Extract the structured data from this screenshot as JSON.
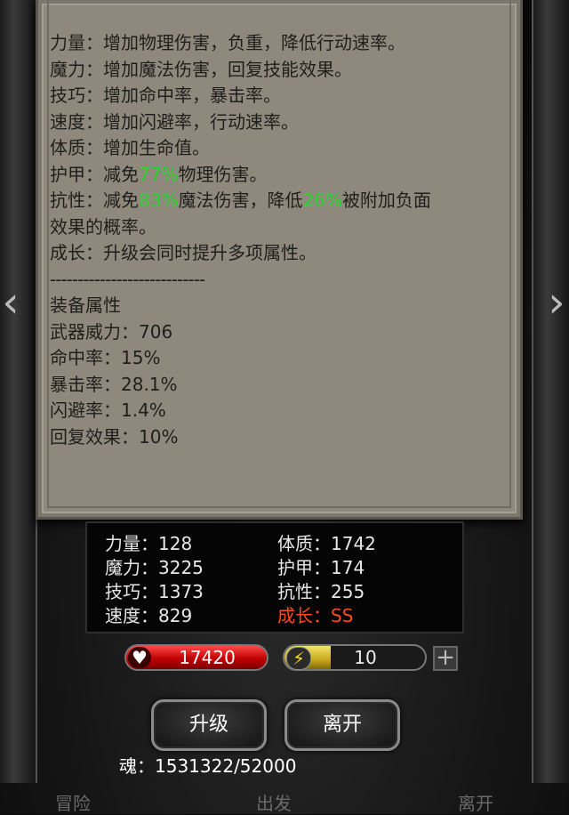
{
  "info": {
    "lines": [
      "力量：增加物理伤害，负重，降低行动速率。",
      "魔力：增加魔法伤害，回复技能效果。",
      "技巧：增加命中率，暴击率。",
      "速度：增加闪避率，行动速率。",
      "体质：增加生命值。"
    ],
    "armor_prefix": "护甲：减免",
    "armor_pct": "77%",
    "armor_suffix": "物理伤害。",
    "resist_prefix": "抗性：减免",
    "resist_pct1": "83%",
    "resist_mid": "魔法伤害，降低",
    "resist_pct2": "26%",
    "resist_suffix": "被附加负面效果的概率。",
    "growth_line": "成长：升级会同时提升多项属性。",
    "divider": "----------------------------",
    "equip_title": "装备属性",
    "equip": [
      "武器威力：706",
      "命中率：15%",
      "暴击率：28.1%",
      "闪避率：1.4%",
      "回复效果：10%"
    ]
  },
  "stats": {
    "strength": "力量：128",
    "magic": "魔力：3225",
    "skill": "技巧：1373",
    "speed": "速度：829",
    "constitution": "体质：1742",
    "armor": "护甲：174",
    "resist": "抗性：255",
    "growth": "成长：SS"
  },
  "hp": {
    "value": "17420"
  },
  "energy": {
    "value": "10",
    "fill_fraction": 0.13
  },
  "buttons": {
    "upgrade": "升级",
    "leave": "离开",
    "plus": "+"
  },
  "soul": "魂：1531322/52000",
  "nav": {
    "adventure": "冒险",
    "depart": "出发",
    "leave": "离开"
  },
  "icons": {
    "hp": "heart-icon",
    "energy": "lightning-icon",
    "left": "chevron-left-icon",
    "right": "chevron-right-icon"
  },
  "colors": {
    "highlight": "#29d629",
    "growth": "#ff4b1f",
    "parchment": "#8e897c"
  }
}
